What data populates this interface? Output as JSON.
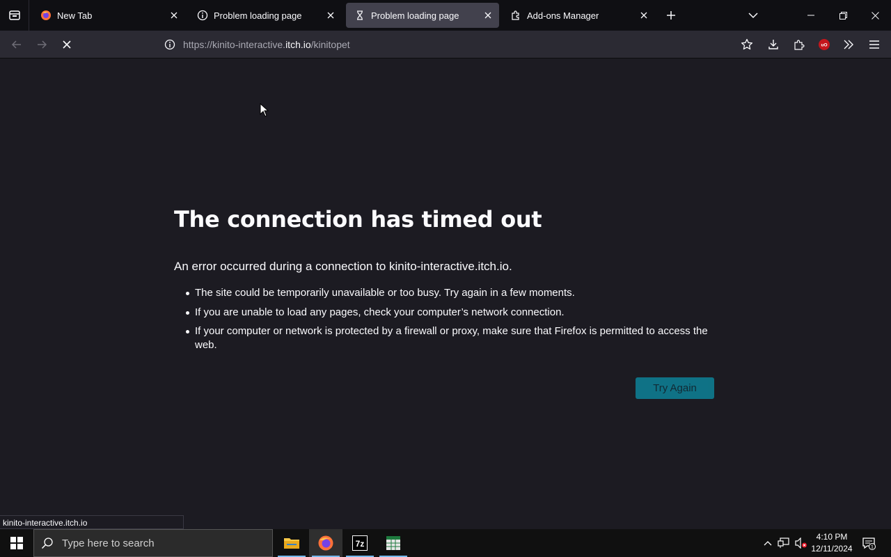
{
  "tabs": [
    {
      "title": "New Tab",
      "icon": "firefox-icon",
      "active": false
    },
    {
      "title": "Problem loading page",
      "icon": "info-icon",
      "active": false
    },
    {
      "title": "Problem loading page",
      "icon": "hourglass-icon",
      "active": true
    },
    {
      "title": "Add-ons Manager",
      "icon": "puzzle-icon",
      "active": false
    }
  ],
  "urlbar": {
    "prefix": "https://kinito-interactive.",
    "domain": "itch.io",
    "path": "/kinitopet"
  },
  "error": {
    "title": "The connection has timed out",
    "description": "An error occurred during a connection to kinito-interactive.itch.io.",
    "items": [
      "The site could be temporarily unavailable or too busy. Try again in a few moments.",
      "If you are unable to load any pages, check your computer’s network connection.",
      "If your computer or network is protected by a firewall or proxy, make sure that Firefox is permitted to access the web."
    ],
    "try_again": "Try Again"
  },
  "status": {
    "text": "kinito-interactive.itch.io"
  },
  "taskbar": {
    "search_placeholder": "Type here to search",
    "time": "4:10 PM",
    "date": "12/11/2024",
    "notifications": "1"
  },
  "colors": {
    "accent": "#00ddff",
    "page_bg": "#1c1b22",
    "toolbar": "#2b2a33",
    "ublock": "#c4161c"
  }
}
